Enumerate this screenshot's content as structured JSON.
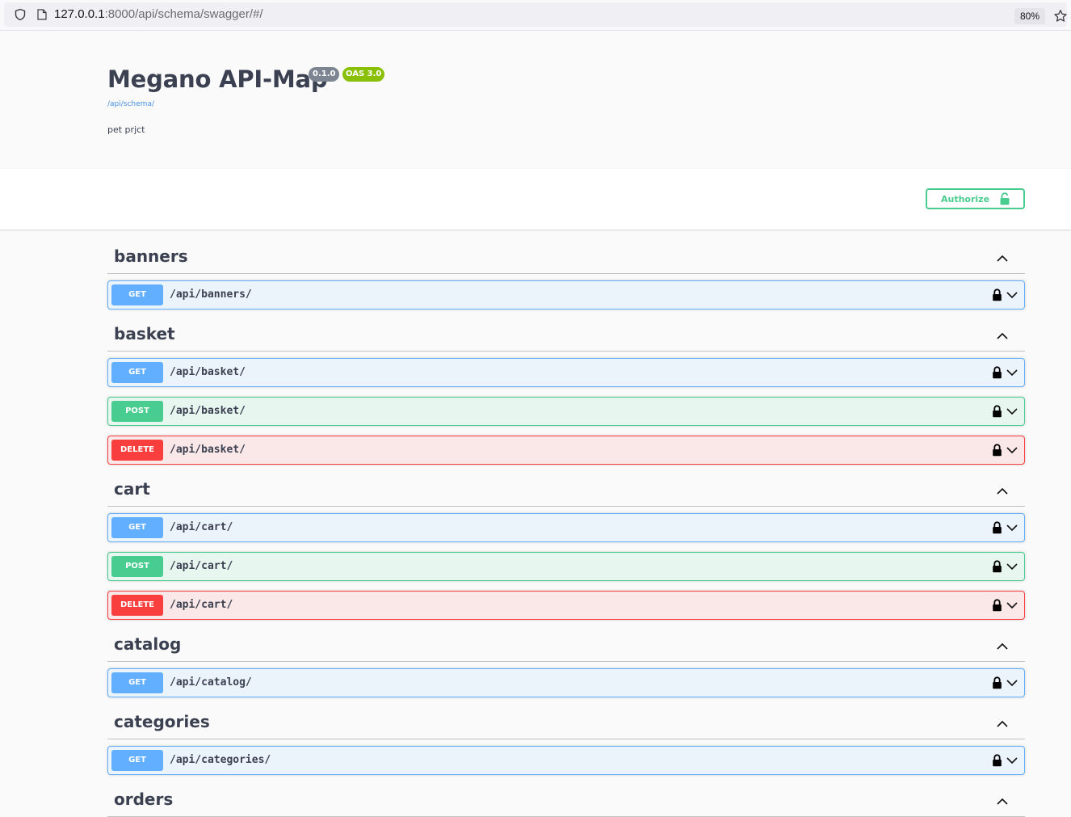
{
  "browser": {
    "url_host": "127.0.0.1",
    "url_path": ":8000/api/schema/swagger/#/",
    "zoom": "80%"
  },
  "info": {
    "title": "Megano API-Map",
    "version": "0.1.0",
    "oas": "OAS 3.0",
    "schema_url": "/api/schema/",
    "description": "pet prjct"
  },
  "auth": {
    "label": "Authorize"
  },
  "colors": {
    "get": "#61affe",
    "post": "#49cc90",
    "delete": "#f93e3e",
    "authorize": "#49cc90"
  },
  "tags": [
    {
      "name": "banners",
      "operations": [
        {
          "method": "GET",
          "path": "/api/banners/"
        }
      ]
    },
    {
      "name": "basket",
      "operations": [
        {
          "method": "GET",
          "path": "/api/basket/"
        },
        {
          "method": "POST",
          "path": "/api/basket/"
        },
        {
          "method": "DELETE",
          "path": "/api/basket/"
        }
      ]
    },
    {
      "name": "cart",
      "operations": [
        {
          "method": "GET",
          "path": "/api/cart/"
        },
        {
          "method": "POST",
          "path": "/api/cart/"
        },
        {
          "method": "DELETE",
          "path": "/api/cart/"
        }
      ]
    },
    {
      "name": "catalog",
      "operations": [
        {
          "method": "GET",
          "path": "/api/catalog/"
        }
      ]
    },
    {
      "name": "categories",
      "operations": [
        {
          "method": "GET",
          "path": "/api/categories/"
        }
      ]
    },
    {
      "name": "orders",
      "operations": []
    }
  ]
}
